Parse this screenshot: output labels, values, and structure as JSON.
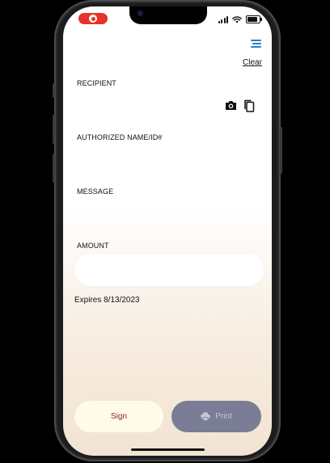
{
  "status_bar": {
    "recording_indicator": "screen-record-icon",
    "icons": [
      "signal-icon",
      "wifi-icon",
      "battery-icon"
    ]
  },
  "header": {
    "menu_icon": "hamburger-menu-icon",
    "clear_label": "Clear"
  },
  "form": {
    "recipient_label": "RECIPIENT",
    "camera_icon": "camera-icon",
    "copy_icon": "copy-icon",
    "authorized_label": "AUTHORIZED NAME/ID#",
    "message_label": "MESSAGE",
    "amount_label": "AMOUNT",
    "amount_value": "",
    "expires_text": "Expires 8/13/2023"
  },
  "actions": {
    "sign_label": "Sign",
    "print_label": "Print",
    "print_icon": "printer-icon"
  },
  "colors": {
    "menu_accent": "#2b7fc0",
    "sign_bg": "#fffbe8",
    "sign_text": "#8a1f1f",
    "print_bg": "#7a7d95",
    "recording_red": "#e8312a"
  }
}
